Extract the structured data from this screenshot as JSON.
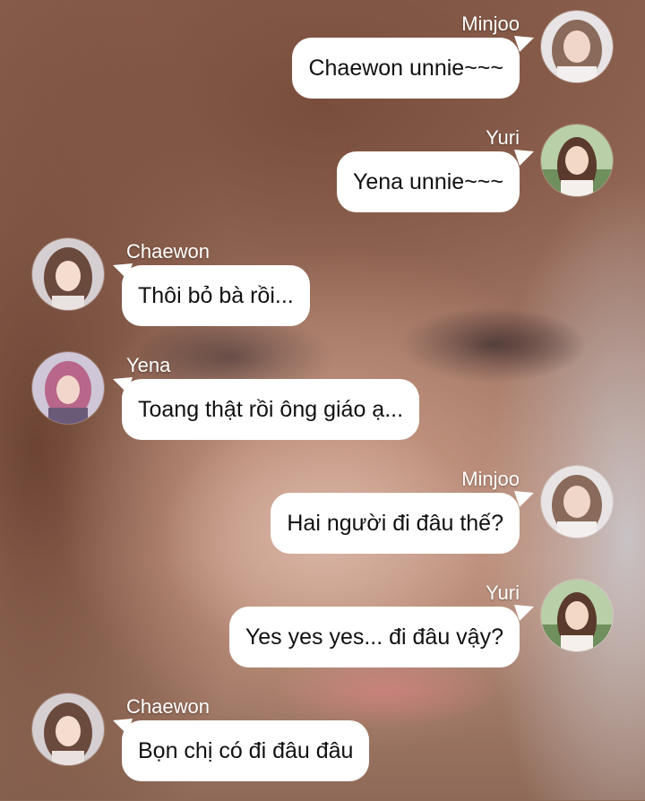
{
  "messages": [
    {
      "sender": "Minjoo",
      "text": "Chaewon unnie~~~",
      "side": "right",
      "avatar": "minjoo-avatar"
    },
    {
      "sender": "Yuri",
      "text": "Yena unnie~~~",
      "side": "right",
      "avatar": "yuri-avatar"
    },
    {
      "sender": "Chaewon",
      "text": "Thôi bỏ bà rồi...",
      "side": "left",
      "avatar": "chaewon-avatar"
    },
    {
      "sender": "Yena",
      "text": "Toang thật rồi ông giáo ạ...",
      "side": "left",
      "avatar": "yena-avatar"
    },
    {
      "sender": "Minjoo",
      "text": "Hai người đi đâu thế?",
      "side": "right",
      "avatar": "minjoo-avatar"
    },
    {
      "sender": "Yuri",
      "text": "Yes yes yes... đi đâu vậy?",
      "side": "right",
      "avatar": "yuri-avatar"
    },
    {
      "sender": "Chaewon",
      "text": "Bọn chị có đi đâu đâu",
      "side": "left",
      "avatar": "chaewon-avatar"
    }
  ],
  "colors": {
    "bubble": "#ffffff",
    "name_text": "#ffffff",
    "message_text": "#111111"
  }
}
